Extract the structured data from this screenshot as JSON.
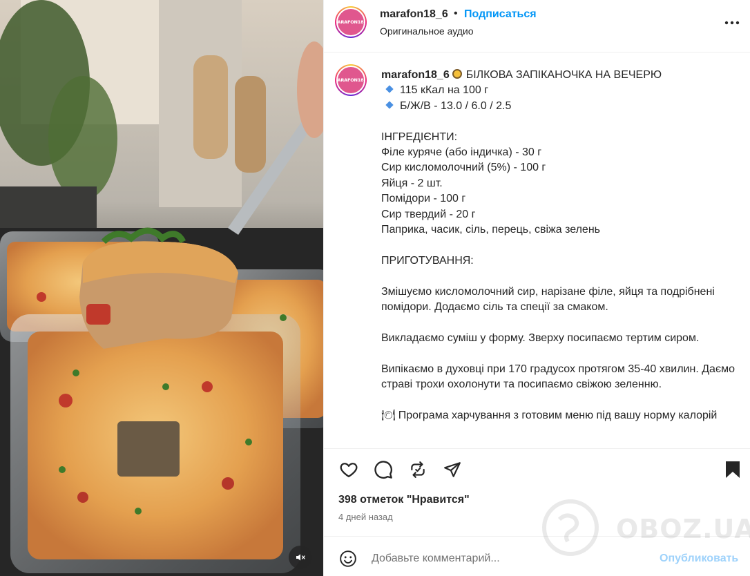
{
  "post": {
    "username": "marafon18_6",
    "avatar_text": "MARAFON18_6",
    "follow_label": "Подписаться",
    "audio_label": "Оригинальное аудио",
    "separator": "•"
  },
  "caption": {
    "username": "marafon18_6",
    "title": "БІЛКОВА ЗАПІКАНОЧКА НА ВЕЧЕРЮ",
    "macros": [
      "115 кКал на 100 г",
      "Б/Ж/В - 13.0 / 6.0 / 2.5"
    ],
    "ingredients_heading": "ІНГРЕДІЄНТИ:",
    "ingredients": [
      "Філе куряче (або індичка) - 30 г",
      "Сир кисломолочний (5%) - 100 г",
      "Яйця - 2 шт.",
      "Помідори - 100 г",
      "Сир твердий - 20 г",
      "Паприка, часик, сіль, перець, свіжа зелень"
    ],
    "cooking_heading": "ПРИГОТУВАННЯ:",
    "steps": [
      "Змішуємо кисломолочний сир, нарізане філе, яйця та подрібнені помідори. Додаємо сіль та спеції за смаком.",
      "Викладаємо суміш у форму. Зверху посипаємо тертим сиром.",
      "Випікаємо в духовці при 170 градусох протягом 35-40 хвилин. Даємо страві трохи охолонути та посипаємо свіжою зеленню."
    ],
    "promo": "🍽 Програма харчування з готовим меню під вашу норму калорій"
  },
  "stats": {
    "likes": "398 отметок \"Нравится\"",
    "posted": "4 дней назад"
  },
  "comment": {
    "placeholder": "Добавьте комментарий...",
    "publish_label": "Опубликовать"
  },
  "watermark": "OBOZ.UA",
  "icons": {
    "like": "heart-icon",
    "comment": "comment-icon",
    "repost": "repost-icon",
    "share": "share-icon",
    "save": "bookmark-icon",
    "more": "more-icon",
    "emoji": "emoji-icon",
    "mute": "muted-speaker-icon"
  },
  "colors": {
    "accent": "#0095f6",
    "publish_disabled": "#9ed2fb",
    "muted_text": "#737373",
    "text": "#262626"
  }
}
